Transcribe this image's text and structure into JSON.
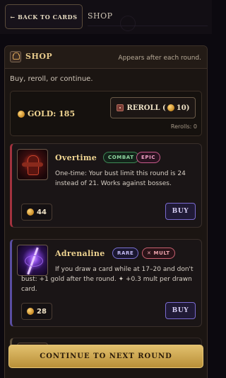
{
  "topbar": {
    "back_label": "← BACK TO CARDS",
    "title": "SHOP"
  },
  "shop": {
    "title": "SHOP",
    "subtitle": "Appears after each round.",
    "intro": "Buy, reroll, or continue.",
    "gold_label": "GOLD: 185",
    "reroll_label": "REROLL (",
    "reroll_cost": "10)",
    "rerolls_text": "Rerolls: 0"
  },
  "items": [
    {
      "name": "Overtime",
      "badges": [
        "COMBAT",
        "EPIC"
      ],
      "description": "One-time: Your bust limit this round is 24 instead of 21. Works against bosses.",
      "price": "44",
      "buy_label": "BUY",
      "accent": "#a3323e"
    },
    {
      "name": "Adrenaline",
      "badges": [
        "RARE",
        "✕ MULT"
      ],
      "description": "If you draw a card while at 17–20 and don't bust: +1 gold after the round. ✦ +0.3 mult per drawn card.",
      "price": "28",
      "buy_label": "BUY",
      "accent": "#5a4ea3"
    }
  ],
  "continue_label": "CONTINUE TO NEXT ROUND",
  "colors": {
    "gold": "#f0d592",
    "background": "#0c090f",
    "continue": "#d4b05a"
  }
}
